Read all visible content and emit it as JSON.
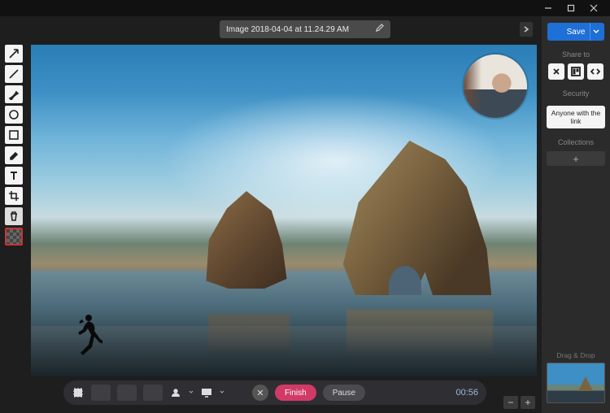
{
  "window": {
    "minimize": "—",
    "maximize": "▢",
    "close": "✕"
  },
  "file": {
    "name": "Image 2018-04-04 at 11.24.29 AM"
  },
  "tools": [
    {
      "id": "arrow",
      "name": "arrow-tool"
    },
    {
      "id": "line",
      "name": "line-tool"
    },
    {
      "id": "pen",
      "name": "pen-tool"
    },
    {
      "id": "ellipse",
      "name": "ellipse-tool"
    },
    {
      "id": "rectangle",
      "name": "rectangle-tool"
    },
    {
      "id": "highlight",
      "name": "highlighter-tool"
    },
    {
      "id": "text",
      "name": "text-tool"
    },
    {
      "id": "crop",
      "name": "crop-tool"
    },
    {
      "id": "delete",
      "name": "delete-tool"
    }
  ],
  "swatch": {
    "border": "#c33"
  },
  "right": {
    "save": "Save",
    "share_label": "Share to",
    "security_label": "Security",
    "security_value": "Anyone with the link",
    "collections_label": "Collections",
    "add": "+",
    "drag_label": "Drag & Drop"
  },
  "record": {
    "finish": "Finish",
    "pause": "Pause",
    "time": "00:56",
    "close": "✕"
  },
  "zoom": {
    "out": "−",
    "in": "+"
  }
}
